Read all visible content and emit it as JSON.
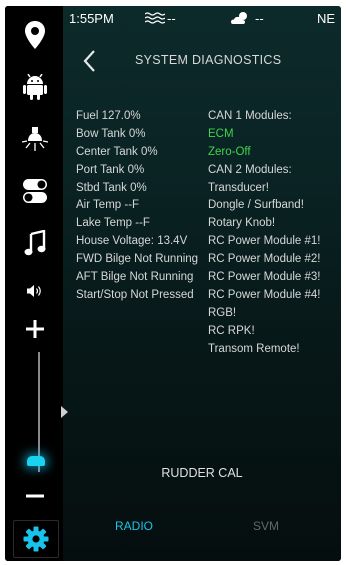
{
  "status": {
    "time": "1:55PM",
    "wave_value": "--",
    "weather_value": "--",
    "heading": "NE"
  },
  "header": {
    "title": "SYSTEM DIAGNOSTICS"
  },
  "diagnostics_left": [
    "Fuel 127.0%",
    "Bow Tank 0%",
    "Center Tank 0%",
    "Port Tank 0%",
    "Stbd Tank 0%",
    "Air Temp --F",
    "Lake Temp --F",
    "House Voltage: 13.4V",
    "FWD Bilge Not Running",
    "AFT Bilge Not Running",
    "Start/Stop Not Pressed"
  ],
  "diagnostics_right": [
    "CAN 1 Modules:",
    "ECM",
    "Zero-Off",
    "CAN 2 Modules:",
    "Transducer!",
    "Dongle / Surfband!",
    "Rotary Knob!",
    "RC Power Module #1!",
    "RC Power Module #2!",
    "RC Power Module #3!",
    "RC Power Module #4!",
    "RGB!",
    "RC RPK!",
    "Transom Remote!"
  ],
  "rudder_cal": "RUDDER CAL",
  "tabs": {
    "radio": "RADIO",
    "svm": "SVM"
  },
  "volume_level": 0.05,
  "colors": {
    "accent": "#1cc4e8",
    "ok": "#3fd44a",
    "inactive_tab": "#5d6b6b"
  },
  "icons": [
    "location-pin-icon",
    "android-icon",
    "light-bulb-icon",
    "toggle-switches-icon",
    "music-note-icon",
    "speaker-icon",
    "plus-icon",
    "minus-icon",
    "gear-icon",
    "back-chevron-icon",
    "waves-icon",
    "weather-icon"
  ]
}
